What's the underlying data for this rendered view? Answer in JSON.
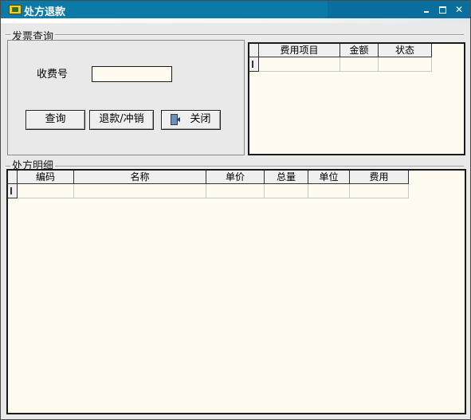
{
  "window": {
    "title": "处方退款",
    "icon": "folder-icon",
    "accent_color": "#0b7aa6"
  },
  "invoice_query": {
    "section_title": "发票查询",
    "receipt_no_label": "收费号",
    "receipt_no_value": "",
    "query_button": "查询",
    "refund_button": "退款/冲销",
    "close_button": "关闭"
  },
  "fee_grid": {
    "columns": [
      "费用项目",
      "金额",
      "状态"
    ],
    "rows": [
      [
        "",
        "",
        ""
      ]
    ]
  },
  "prescription_detail": {
    "section_title": "处方明细",
    "columns": [
      "编码",
      "名称",
      "单价",
      "总量",
      "单位",
      "费用"
    ],
    "rows": [
      [
        "",
        "",
        "",
        "",
        "",
        ""
      ]
    ]
  }
}
